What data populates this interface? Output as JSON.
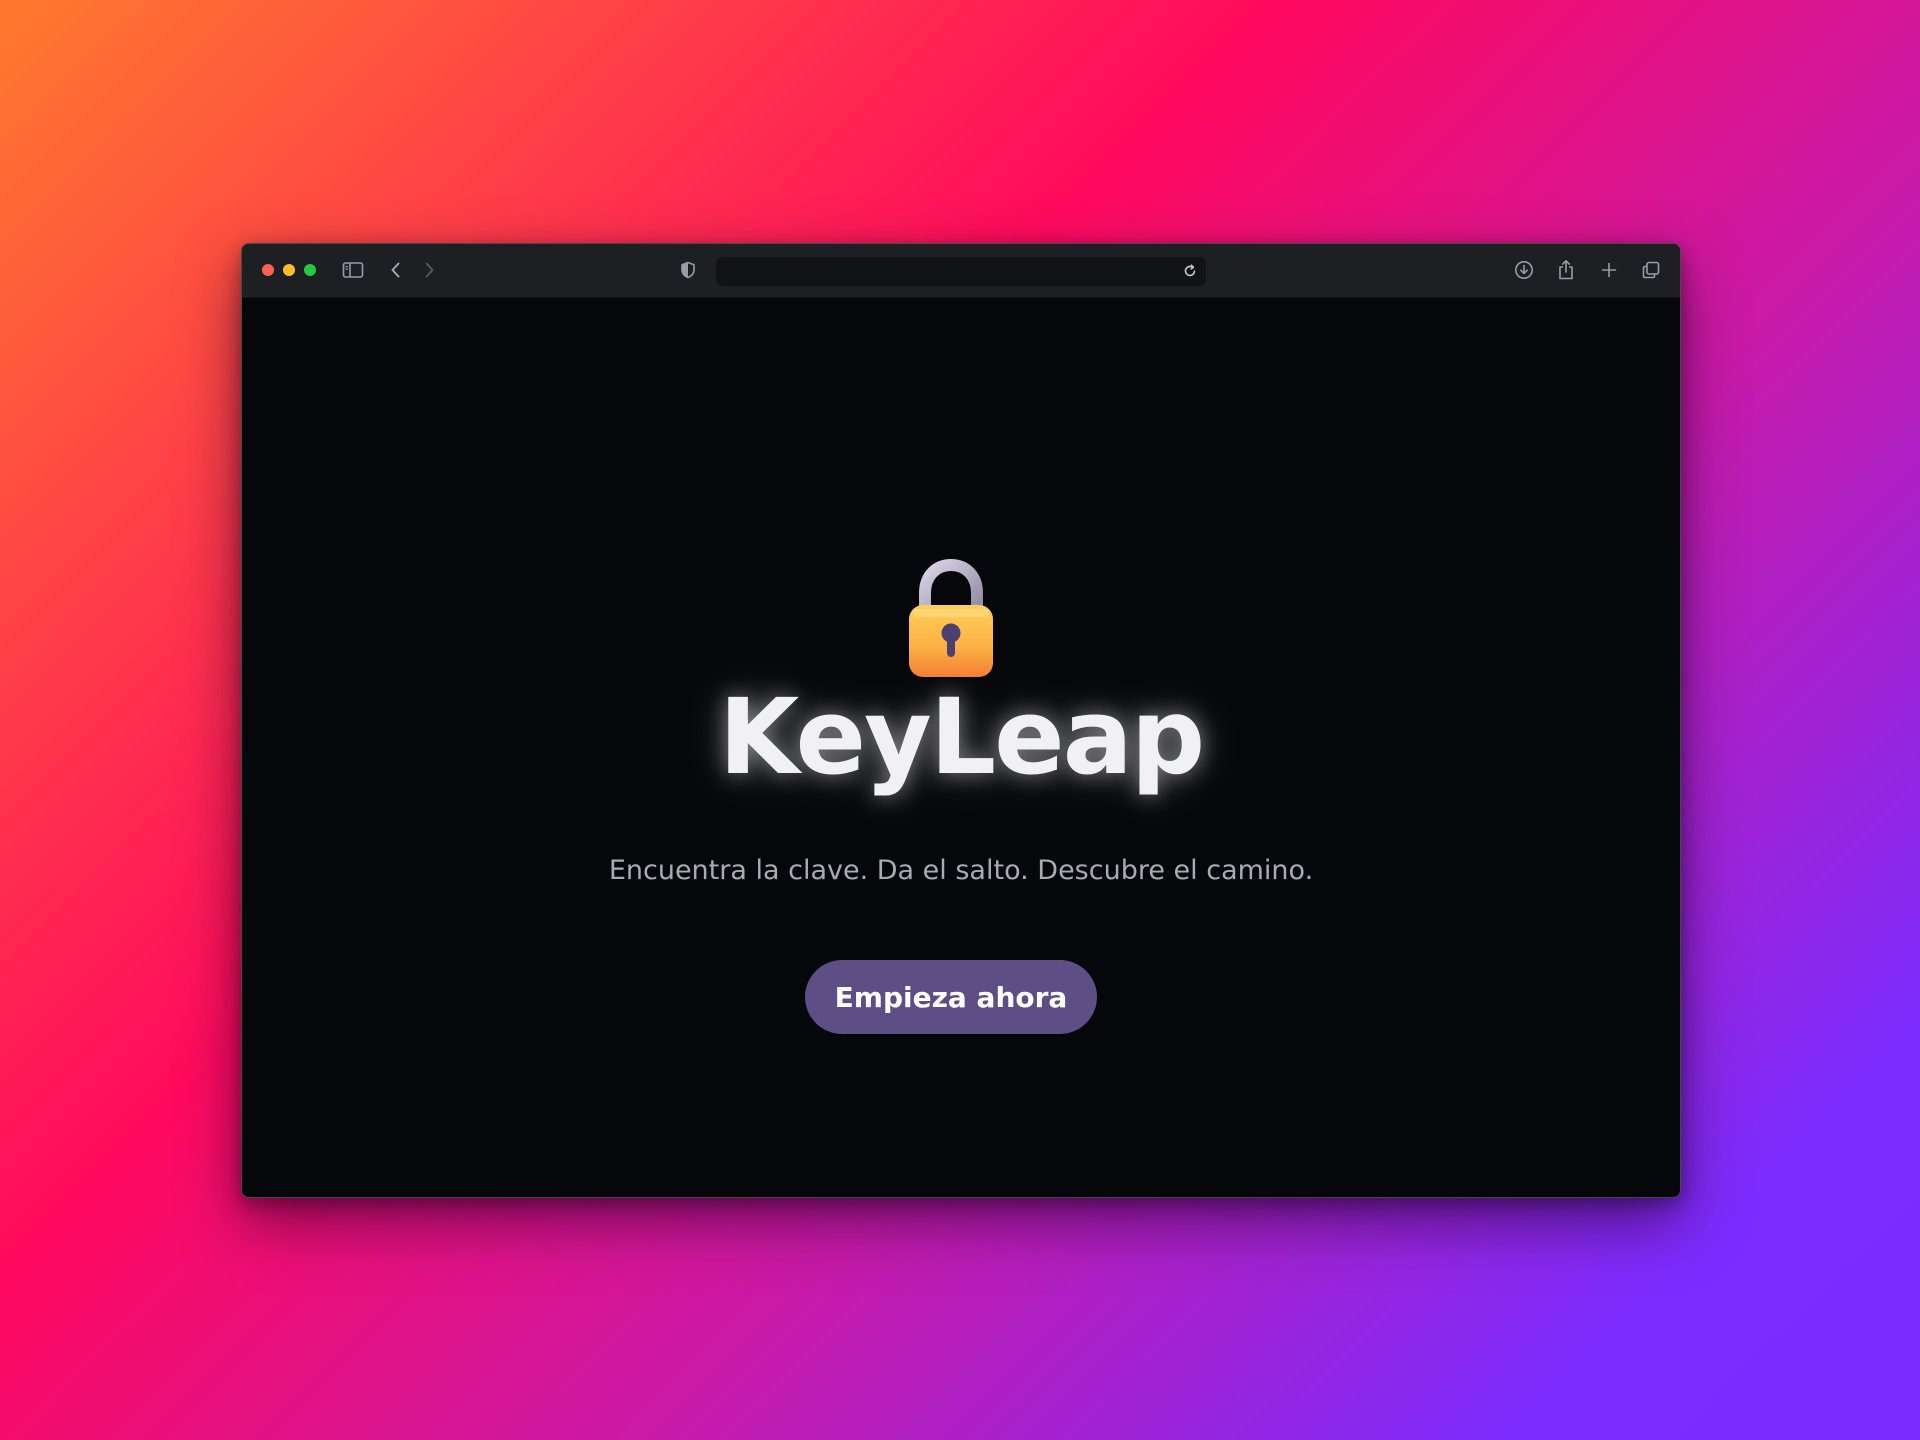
{
  "browser": {
    "url": "",
    "icons": {
      "sidebar": "sidebar-icon",
      "back": "chevron-left-icon",
      "forward": "chevron-right-icon",
      "privacy": "shield-icon",
      "reload": "reload-icon",
      "downloads": "download-icon",
      "share": "share-icon",
      "new_tab": "plus-icon",
      "tabs": "tab-overview-icon"
    }
  },
  "hero": {
    "icon": "lock-icon",
    "title": "KeyLeap",
    "subtitle": "Encuentra la clave. Da el salto. Descubre el camino.",
    "cta_label": "Empieza ahora"
  },
  "colors": {
    "page_background": "#05070b",
    "toolbar": "#1d1f23",
    "cta_background": "#5d4f85",
    "lock_body": "#f8a93a",
    "lock_shackle": "#b7b2c8"
  }
}
